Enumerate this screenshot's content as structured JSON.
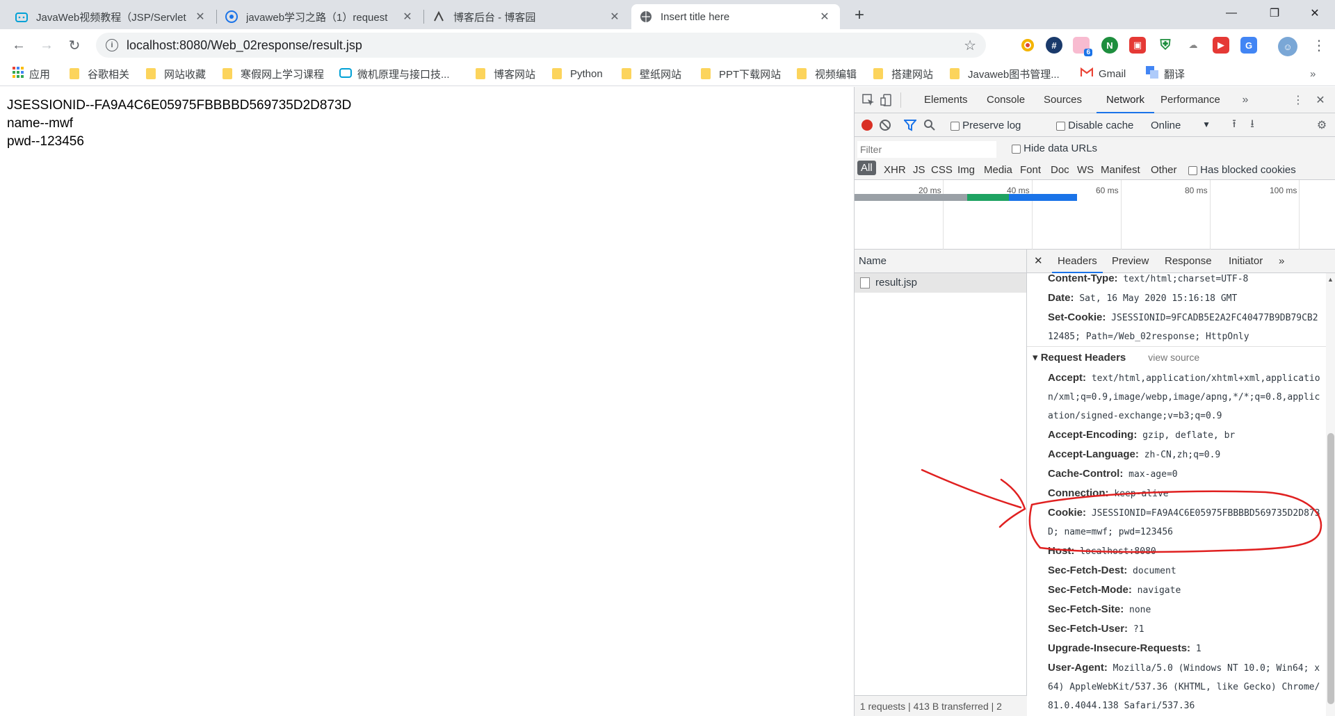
{
  "tabs": [
    {
      "title": "JavaWeb视频教程（JSP/Servlet",
      "icon": "bilibili-icon",
      "active": false
    },
    {
      "title": "javaweb学习之路（1）request",
      "icon": "cnblogs-icon",
      "active": false
    },
    {
      "title": "博客后台 - 博客园",
      "icon": "cnblogs-admin-icon",
      "active": false
    },
    {
      "title": "Insert title here",
      "icon": "globe-icon",
      "active": true
    }
  ],
  "tab_close": "✕",
  "new_tab": "+",
  "address_bar": {
    "url": "localhost:8080/Web_02response/result.jsp"
  },
  "ext_badge": "6",
  "bookmarks": [
    {
      "label": "应用",
      "type": "apps"
    },
    {
      "label": "谷歌相关",
      "type": "folder"
    },
    {
      "label": "网站收藏",
      "type": "folder"
    },
    {
      "label": "寒假网上学习课程",
      "type": "folder"
    },
    {
      "label": "微机原理与接口技...",
      "type": "bilibili"
    },
    {
      "label": "博客网站",
      "type": "folder"
    },
    {
      "label": "Python",
      "type": "folder"
    },
    {
      "label": "壁纸网站",
      "type": "folder"
    },
    {
      "label": "PPT下载网站",
      "type": "folder"
    },
    {
      "label": "视频编辑",
      "type": "folder"
    },
    {
      "label": "搭建网站",
      "type": "folder"
    },
    {
      "label": "Javaweb图书管理...",
      "type": "folder"
    },
    {
      "label": "Gmail",
      "type": "gmail"
    },
    {
      "label": "翻译",
      "type": "translate"
    }
  ],
  "page": {
    "lines": [
      "JSESSIONID--FA9A4C6E05975FBBBBD569735D2D873D",
      "name--mwf",
      "pwd--123456"
    ]
  },
  "devtools": {
    "tabs": [
      "Elements",
      "Console",
      "Sources",
      "Network",
      "Performance"
    ],
    "active_tab": "Network",
    "preserve_log": "Preserve log",
    "disable_cache": "Disable cache",
    "throttle": "Online",
    "filter_placeholder": "Filter",
    "hide_data_urls": "Hide data URLs",
    "type_filters": [
      "All",
      "XHR",
      "JS",
      "CSS",
      "Img",
      "Media",
      "Font",
      "Doc",
      "WS",
      "Manifest",
      "Other"
    ],
    "has_blocked_cookies": "Has blocked cookies",
    "timeline_ticks": [
      "20 ms",
      "40 ms",
      "60 ms",
      "80 ms",
      "100 ms"
    ],
    "name_header": "Name",
    "requests": [
      "result.jsp"
    ],
    "summary": "1 requests | 413 B transferred | 2",
    "detail_tabs": [
      "Headers",
      "Preview",
      "Response",
      "Initiator"
    ],
    "response_headers": [
      {
        "key": "Content-Type:",
        "value": "text/html;charset=UTF-8"
      },
      {
        "key": "Date:",
        "value": "Sat, 16 May 2020 15:16:18 GMT"
      },
      {
        "key": "Set-Cookie:",
        "value": "JSESSIONID=9FCADB5E2A2FC40477B9DB79CB212485; Path=/Web_02response; HttpOnly"
      }
    ],
    "request_section": "Request Headers",
    "view_source": "view source",
    "request_headers": [
      {
        "key": "Accept:",
        "value": "text/html,application/xhtml+xml,application/xml;q=0.9,image/webp,image/apng,*/*;q=0.8,application/signed-exchange;v=b3;q=0.9"
      },
      {
        "key": "Accept-Encoding:",
        "value": "gzip, deflate, br"
      },
      {
        "key": "Accept-Language:",
        "value": "zh-CN,zh;q=0.9"
      },
      {
        "key": "Cache-Control:",
        "value": "max-age=0"
      },
      {
        "key": "Connection:",
        "value": "keep-alive"
      },
      {
        "key": "Cookie:",
        "value": "JSESSIONID=FA9A4C6E05975FBBBBD569735D2D873D; name=mwf; pwd=123456"
      },
      {
        "key": "Host:",
        "value": "localhost:8080"
      },
      {
        "key": "Sec-Fetch-Dest:",
        "value": "document"
      },
      {
        "key": "Sec-Fetch-Mode:",
        "value": "navigate"
      },
      {
        "key": "Sec-Fetch-Site:",
        "value": "none"
      },
      {
        "key": "Sec-Fetch-User:",
        "value": "?1"
      },
      {
        "key": "Upgrade-Insecure-Requests:",
        "value": "1"
      },
      {
        "key": "User-Agent:",
        "value": "Mozilla/5.0 (Windows NT 10.0; Win64; x64) AppleWebKit/537.36 (KHTML, like Gecko) Chrome/81.0.4044.138 Safari/537.36"
      }
    ]
  },
  "colors": {
    "accent": "#1a73e8",
    "record": "#d93025",
    "annotation": "#e02020"
  }
}
